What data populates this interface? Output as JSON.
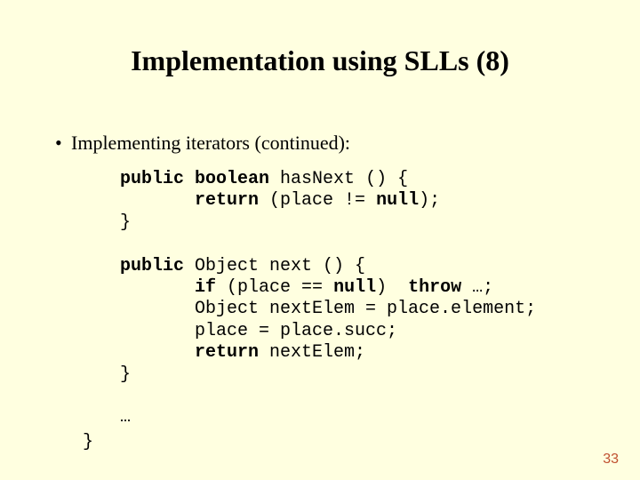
{
  "title": "Implementation using SLLs (8)",
  "bullet": {
    "marker": "•",
    "text": "Implementing iterators (continued):"
  },
  "kw": {
    "public": "public",
    "boolean": "boolean",
    "return": "return",
    "null": "null",
    "if": "if",
    "throw": "throw"
  },
  "code": {
    "l1b": " hasNext () {",
    "l2a": "       ",
    "l2b": " (place != ",
    "l2c": ");",
    "l3": "}",
    "blank1": "",
    "l4b": " Object next () {",
    "l5a": "       ",
    "l5b": " (place == ",
    "l5c": ")  ",
    "l5d": " …;",
    "l6": "       Object nextElem = place.element;",
    "l7": "       place = place.succ;",
    "l8a": "       ",
    "l8b": " nextElem;",
    "l9": "}",
    "blank2": "",
    "ell": "…"
  },
  "closing": "}",
  "pagenum": "33"
}
